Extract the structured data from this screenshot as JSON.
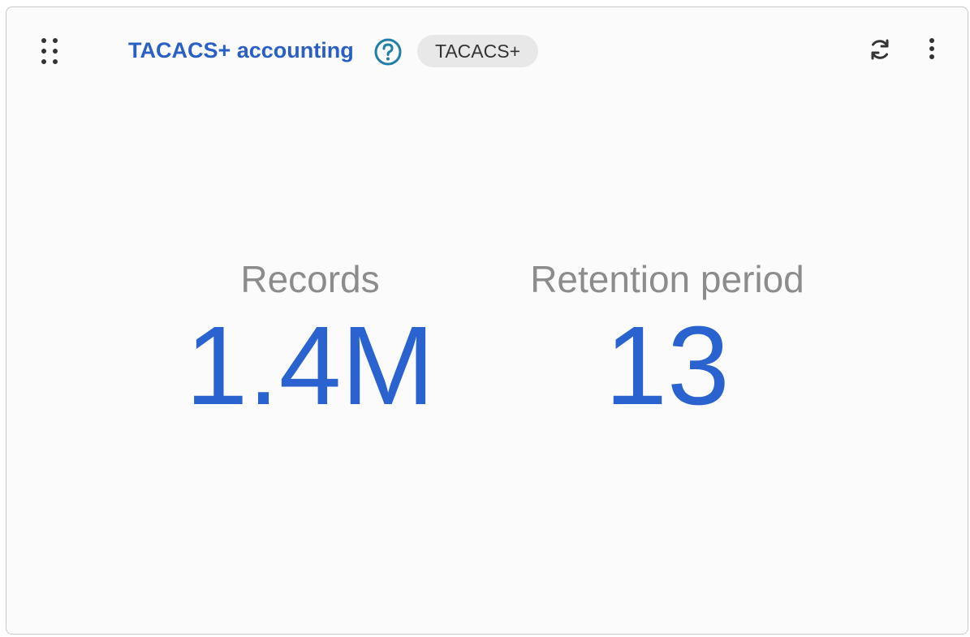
{
  "widget": {
    "title": "TACACS+ accounting",
    "badge": "TACACS+",
    "icons": {
      "drag": "drag-handle-icon",
      "help": "help-circle-icon",
      "refresh": "refresh-icon",
      "more": "more-vertical-icon"
    },
    "colors": {
      "accent": "#2a62cf",
      "title": "#2a5fc4",
      "help": "#1f7fa8",
      "label": "#8c8c8c",
      "badge_bg": "#e8e8e8"
    }
  },
  "stats": [
    {
      "label": "Records",
      "value": "1.4M"
    },
    {
      "label": "Retention period",
      "value": "13"
    }
  ]
}
